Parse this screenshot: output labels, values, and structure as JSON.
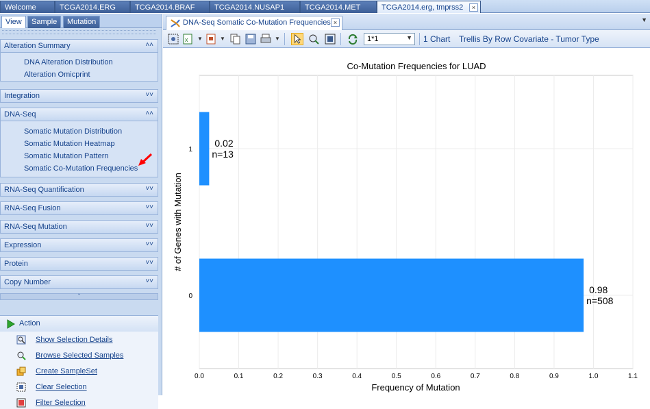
{
  "doc_tabs": [
    "Welcome",
    "TCGA2014.ERG",
    "TCGA2014.BRAF",
    "TCGA2014.NUSAP1",
    "TCGA2014.MET",
    "TCGA2014.erg, tmprss2"
  ],
  "close_glyph": "×",
  "left_tabs": [
    "View",
    "Sample",
    "Mutation"
  ],
  "groups": {
    "alteration": {
      "title": "Alteration Summary",
      "items": [
        "DNA Alteration Distribution",
        "Alteration Omicprint"
      ]
    },
    "integration": {
      "title": "Integration"
    },
    "dnaseq": {
      "title": "DNA-Seq",
      "items": [
        "Somatic Mutation Distribution",
        "Somatic Mutation Heatmap",
        "Somatic Mutation Pattern",
        "Somatic Co-Mutation Frequencies"
      ]
    },
    "rnaseq_quant": {
      "title": "RNA-Seq Quantification"
    },
    "rnaseq_fusion": {
      "title": "RNA-Seq Fusion"
    },
    "rnaseq_mutation": {
      "title": "RNA-Seq Mutation"
    },
    "expression": {
      "title": "Expression"
    },
    "protein": {
      "title": "Protein"
    },
    "copy_number": {
      "title": "Copy Number"
    }
  },
  "action": {
    "title": "Action",
    "items": [
      "Show Selection Details",
      "Browse Selected Samples",
      "Create SampleSet",
      "Clear Selection",
      "Filter Selection"
    ]
  },
  "sub_tab": {
    "label": "DNA-Seq Somatic Co-Mutation Frequencies"
  },
  "toolbar": {
    "layout_value": "1*1",
    "chart_count": "1 Chart",
    "trellis": "Trellis By Row Covariate - Tumor Type"
  },
  "colors": {
    "bar": "#1e90ff",
    "arrow": "#ff0000"
  },
  "chart_data": {
    "type": "bar",
    "orientation": "horizontal",
    "title": "Co-Mutation Frequencies for LUAD",
    "xlabel": "Frequency of Mutation",
    "ylabel": "# of Genes with Mutation",
    "xlim": [
      0,
      1.1
    ],
    "xticks": [
      "0.0",
      "0.1",
      "0.2",
      "0.3",
      "0.4",
      "0.5",
      "0.6",
      "0.7",
      "0.8",
      "0.9",
      "1.0",
      "1.1"
    ],
    "categories": [
      "0",
      "1"
    ],
    "values": [
      0.975,
      0.025
    ],
    "value_labels": [
      "0.98",
      "0.02"
    ],
    "n_labels": [
      "n=508",
      "n=13"
    ],
    "grid": true
  }
}
